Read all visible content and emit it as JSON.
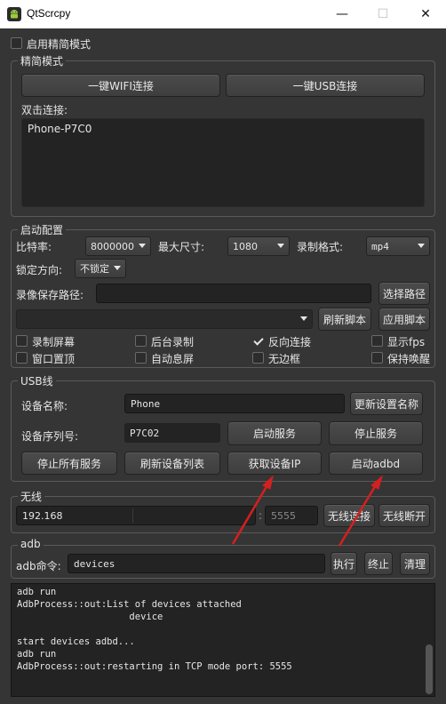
{
  "window": {
    "title": "QtScrcpy",
    "minimize": "—",
    "maximize": "☐",
    "close": "✕"
  },
  "simple_mode": {
    "label": "启用精简模式",
    "checked": false
  },
  "simple_group": {
    "title": "精简模式",
    "wifi_button": "一键WIFI连接",
    "usb_button": "一键USB连接",
    "double_click_label": "双击连接:",
    "devices": [
      "Phone-P7C0"
    ]
  },
  "start_config": {
    "title": "启动配置",
    "bitrate_label": "比特率:",
    "bitrate_value": "8000000",
    "maxsize_label": "最大尺寸:",
    "maxsize_value": "1080",
    "format_label": "录制格式:",
    "format_value": "mp4",
    "lock_label": "锁定方向:",
    "lock_value": "不锁定",
    "save_path_label": "录像保存路径:",
    "save_path_value": "",
    "select_path_button": "选择路径",
    "script_value": "",
    "refresh_script_button": "刷新脚本",
    "apply_script_button": "应用脚本",
    "options": [
      {
        "label": "录制屏幕",
        "checked": false
      },
      {
        "label": "后台录制",
        "checked": false
      },
      {
        "label": "反向连接",
        "checked": true
      },
      {
        "label": "显示fps",
        "checked": false
      },
      {
        "label": "窗口置顶",
        "checked": false
      },
      {
        "label": "自动息屏",
        "checked": false
      },
      {
        "label": "无边框",
        "checked": false
      },
      {
        "label": "保持唤醒",
        "checked": false
      }
    ]
  },
  "usb": {
    "title": "USB线",
    "device_name_label": "设备名称:",
    "device_name_value": "Phone",
    "update_name_button": "更新设置名称",
    "serial_label": "设备序列号:",
    "serial_value": "P7C02",
    "start_service_button": "启动服务",
    "stop_service_button": "停止服务",
    "stop_all_button": "停止所有服务",
    "refresh_devices_button": "刷新设备列表",
    "get_ip_button": "获取设备IP",
    "start_adbd_button": "启动adbd"
  },
  "wireless": {
    "title": "无线",
    "ip_value": "192.168",
    "colon": ":",
    "port_placeholder": "5555",
    "connect_button": "无线连接",
    "disconnect_button": "无线断开"
  },
  "adb": {
    "title": "adb",
    "command_label": "adb命令:",
    "command_value": "devices",
    "execute_button": "执行",
    "terminate_button": "终止",
    "clear_button": "清理"
  },
  "log": [
    "adb run",
    "AdbProcess::out:List of devices attached",
    "                    device",
    "",
    "start devices adbd...",
    "adb run",
    "AdbProcess::out:restarting in TCP mode port: 5555"
  ],
  "colors": {
    "background": "#353535",
    "annotation_arrow": "#d61f1f"
  }
}
